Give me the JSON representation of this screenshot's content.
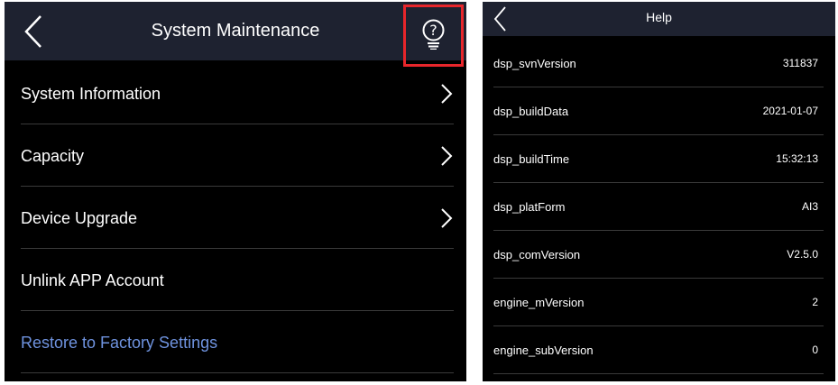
{
  "maintenance": {
    "title": "System Maintenance",
    "back_icon": "chevron-left-icon",
    "help_icon": "help-bulb-icon",
    "highlight_color": "#e8262b",
    "items": [
      {
        "label": "System Information",
        "chevron": true
      },
      {
        "label": "Capacity",
        "chevron": true
      },
      {
        "label": "Device Upgrade",
        "chevron": true
      },
      {
        "label": "Unlink APP Account",
        "chevron": false
      },
      {
        "label": "Restore to Factory Settings",
        "chevron": false,
        "color": "#6f93df"
      }
    ]
  },
  "help": {
    "title": "Help",
    "back_icon": "chevron-left-icon",
    "rows": [
      {
        "key": "dsp_svnVersion",
        "value": "311837"
      },
      {
        "key": "dsp_buildData",
        "value": "2021-01-07"
      },
      {
        "key": "dsp_buildTime",
        "value": "15:32:13"
      },
      {
        "key": "dsp_platForm",
        "value": "AI3"
      },
      {
        "key": "dsp_comVersion",
        "value": "V2.5.0"
      },
      {
        "key": "engine_mVersion",
        "value": "2"
      },
      {
        "key": "engine_subVersion",
        "value": "0"
      }
    ]
  }
}
